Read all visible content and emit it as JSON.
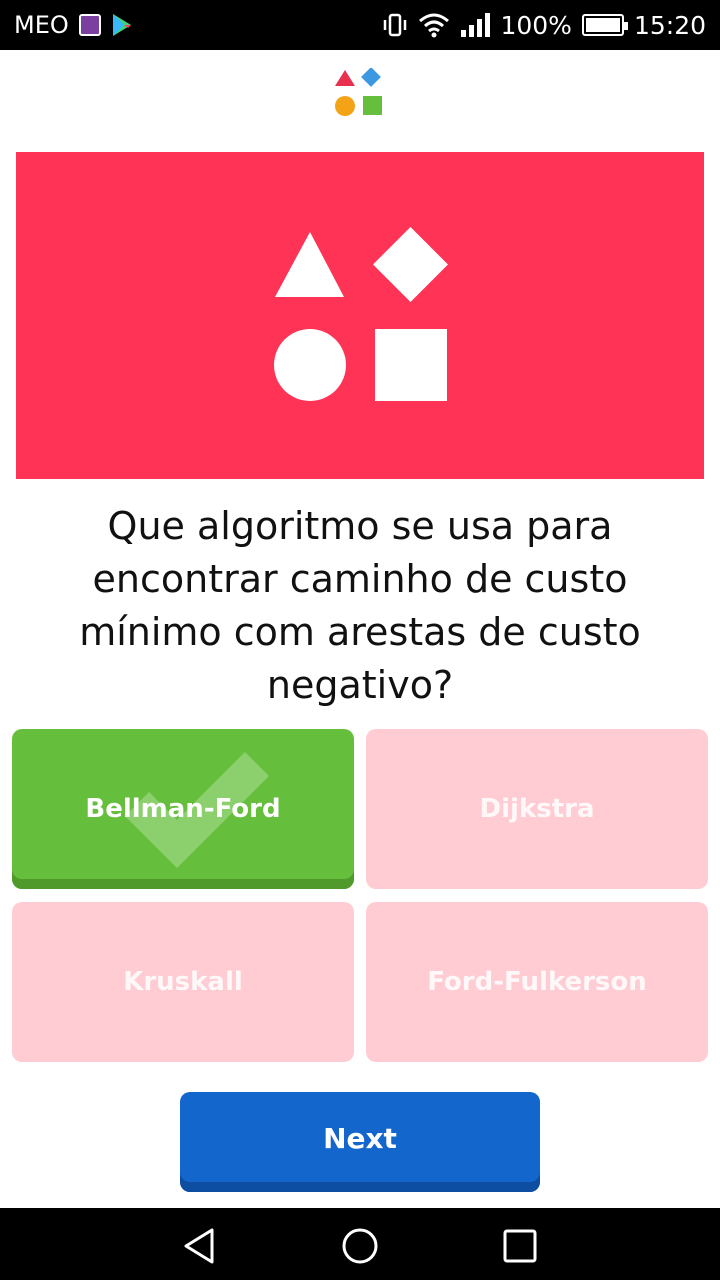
{
  "status_bar": {
    "carrier": "MEO",
    "battery": "100%",
    "battery_level": 1.0,
    "time": "15:20"
  },
  "colors": {
    "banner": "#ff3355",
    "correct": "#66bf3c",
    "wrong": "#ffccd4",
    "next": "#1366cc"
  },
  "quiz": {
    "question": "Que algoritmo se usa para encontrar caminho de custo mínimo com arestas de custo negativo?",
    "answers": [
      {
        "label": "Bellman-Ford",
        "state": "correct"
      },
      {
        "label": "Dijkstra",
        "state": "wrong"
      },
      {
        "label": "Kruskall",
        "state": "wrong"
      },
      {
        "label": "Ford-Fulkerson",
        "state": "wrong"
      }
    ],
    "next_label": "Next"
  },
  "icons": [
    "triangle-icon",
    "diamond-icon",
    "circle-icon",
    "square-icon",
    "check-icon",
    "back-icon",
    "home-icon",
    "recents-icon"
  ]
}
